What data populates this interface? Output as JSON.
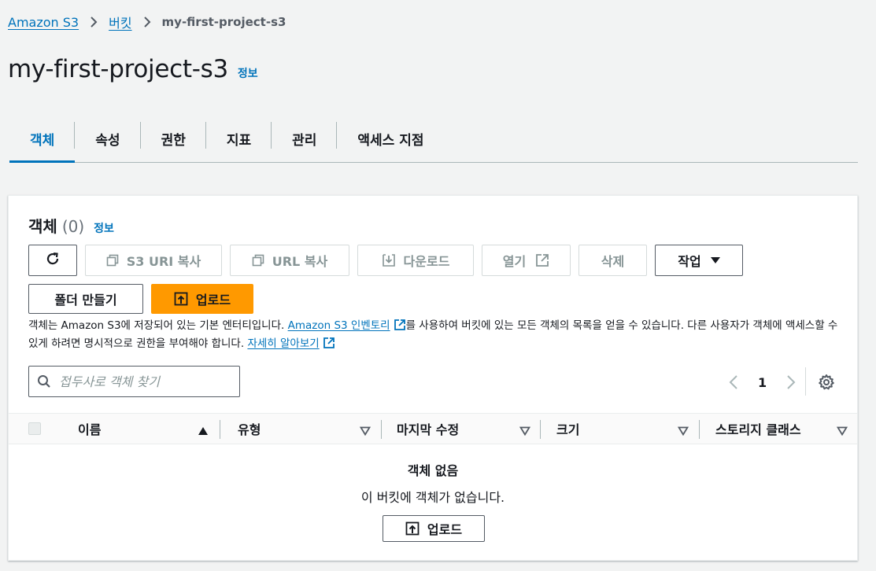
{
  "breadcrumb": {
    "root": "Amazon S3",
    "buckets": "버킷",
    "current": "my-first-project-s3"
  },
  "page": {
    "title": "my-first-project-s3",
    "info": "정보"
  },
  "tabs": [
    {
      "label": "객체",
      "active": true
    },
    {
      "label": "속성",
      "active": false
    },
    {
      "label": "권한",
      "active": false
    },
    {
      "label": "지표",
      "active": false
    },
    {
      "label": "관리",
      "active": false
    },
    {
      "label": "액세스 지점",
      "active": false
    }
  ],
  "objects_panel": {
    "title": "객체",
    "count": "(0)",
    "info": "정보",
    "buttons": {
      "copy_s3_uri": "S3 URI 복사",
      "copy_url": "URL 복사",
      "download": "다운로드",
      "open": "열기",
      "delete": "삭제",
      "actions": "작업",
      "create_folder": "폴더 만들기",
      "upload": "업로드"
    },
    "description": {
      "part1": "객체는 Amazon S3에 저장되어 있는 기본 엔터티입니다. ",
      "inventory_link": "Amazon S3 인벤토리",
      "part2": "를 사용하여 버킷에 있는 모든 객체의 목록을 얻을 수 있습니다. 다른 사용자가 객체에 액세스할 수 있게 하려면 명시적으로 권한을 부여해야 합니다. ",
      "learn_more": "자세히 알아보기"
    },
    "search": {
      "placeholder": "접두사로 객체 찾기",
      "value": ""
    },
    "pagination": {
      "current_page": "1"
    },
    "table": {
      "columns": [
        "이름",
        "유형",
        "마지막 수정",
        "크기",
        "스토리지 클래스"
      ]
    },
    "empty": {
      "title": "객체 없음",
      "message": "이 버킷에 객체가 없습니다.",
      "upload_button": "업로드"
    }
  },
  "colors": {
    "link": "#0073bb",
    "primary_button": "#ff9900",
    "background": "#f2f3f3"
  },
  "icons": {
    "refresh": "refresh-icon",
    "copy": "copy-icon",
    "download": "download-icon",
    "external": "external-link-icon",
    "caret": "caret-down-icon",
    "upload": "upload-icon",
    "search": "search-icon",
    "settings": "gear-icon"
  }
}
